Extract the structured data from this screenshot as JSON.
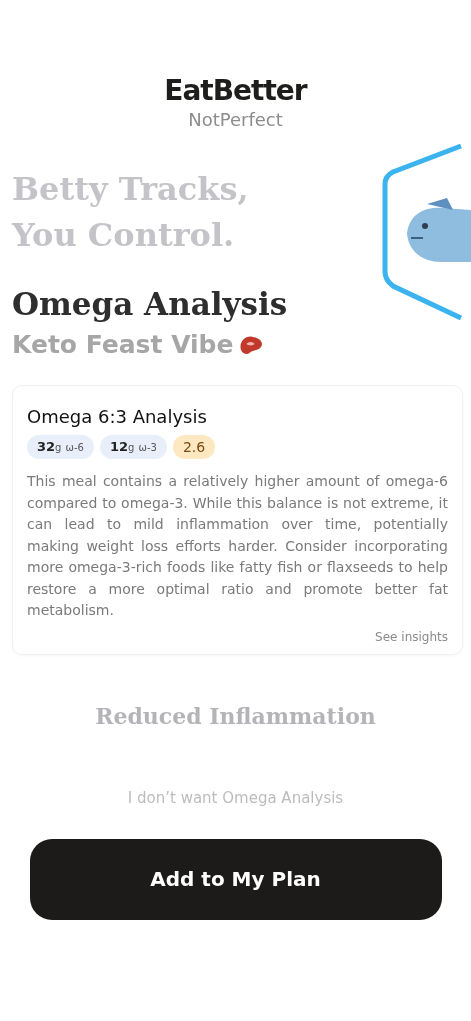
{
  "brand": {
    "name": "EatBetter",
    "tagline": "NotPerfect"
  },
  "hero": {
    "slogan_lines": [
      "Betty Tracks,",
      "You Control."
    ],
    "title": "Omega Analysis",
    "subtitle": "Keto Feast Vibe"
  },
  "card": {
    "title": "Omega 6:3 Analysis",
    "pills": [
      {
        "kind": "amount",
        "value": "32",
        "unit": "g",
        "label": "ω-6"
      },
      {
        "kind": "amount",
        "value": "12",
        "unit": "g",
        "label": "ω-3"
      },
      {
        "kind": "ratio",
        "value": "2.6"
      }
    ],
    "body": "This meal contains a relatively higher amount of omega-6 compared to omega-3. While this balance is not extreme, it can lead to mild inflammation over time, potentially making weight loss efforts harder. Consider incorporating more omega-3-rich foods like fatty fish or flaxseeds to help restore a more optimal ratio and promote better fat metabolism.",
    "link": "See insights"
  },
  "benefit": "Reduced Inflammation",
  "decline": "I don’t want Omega Analysis",
  "primary_button": "Add to My Plan"
}
